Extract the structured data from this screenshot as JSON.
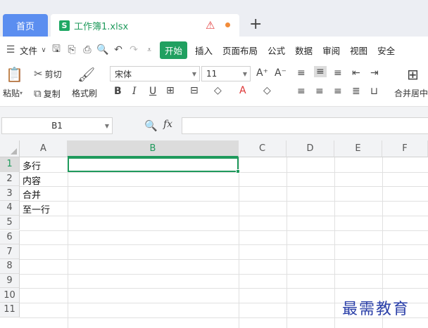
{
  "tabs": {
    "home": "首页",
    "file_icon": "S",
    "file_name": "工作簿1.xlsx",
    "new_tab": "+"
  },
  "menu": {
    "file": "文件",
    "items": [
      "开始",
      "插入",
      "页面布局",
      "公式",
      "数据",
      "审阅",
      "视图",
      "安全"
    ]
  },
  "ribbon": {
    "paste": "粘贴",
    "cut": "剪切",
    "copy": "复制",
    "format_painter": "格式刷",
    "font_name": "宋体",
    "font_size": "11",
    "merge_center": "合并居中"
  },
  "formula_bar": {
    "name_box": "B1",
    "fx": "fx",
    "formula": ""
  },
  "grid": {
    "columns": [
      "A",
      "B",
      "C",
      "D",
      "E",
      "F"
    ],
    "rows": [
      "1",
      "2",
      "3",
      "4",
      "5",
      "6",
      "7",
      "8",
      "9",
      "10",
      "11"
    ],
    "cells_A": [
      "多行",
      "内容",
      "合并",
      "至一行"
    ],
    "active_cell": "B1"
  },
  "watermark": "最需教育",
  "colors": {
    "accent_green": "#1f9a5c",
    "home_tab_blue": "#5b8ef0",
    "watermark_blue": "#2a3fa8"
  }
}
